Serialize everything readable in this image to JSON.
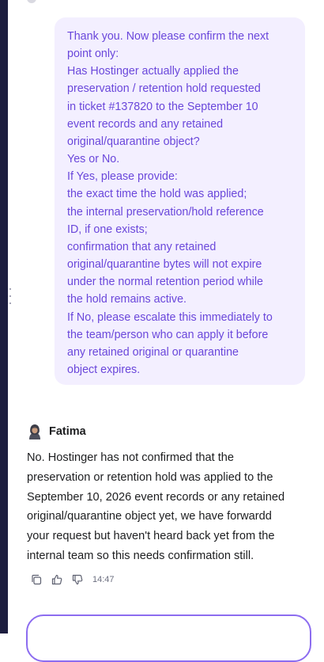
{
  "conversation": {
    "user_message_lines": [
      "Thank you. Now please confirm the next",
      "point only:",
      "Has Hostinger actually applied the",
      "preservation / retention hold requested",
      "in ticket #137820 to the September 10",
      "event records and any retained",
      "original/quarantine object?",
      "Yes or No.",
      "If Yes, please provide:",
      "the exact time the hold was applied;",
      "the internal preservation/hold reference",
      "ID, if one exists;",
      "confirmation that any retained",
      "original/quarantine bytes will not expire",
      "under the normal retention period while",
      "the hold remains active.",
      "If No, please escalate this immediately to",
      "the team/person who can apply it before",
      "any retained original or quarantine",
      "object expires."
    ],
    "assistant": {
      "name": "Fatima",
      "message_lines": [
        "No. Hostinger has not confirmed that the",
        "preservation or retention hold was applied to the",
        "September 10, 2026 event records or any retained",
        "original/quarantine object yet, we have forwardd",
        "your request but haven't heard back yet from the",
        "internal team so this needs confirmation still."
      ],
      "time": "14:47"
    }
  },
  "icons": {
    "copy": "copy-icon",
    "like": "thumbs-up-icon",
    "dislike": "thumbs-down-icon",
    "avatar": "avatar"
  },
  "colors": {
    "rail": "#1d1e3f",
    "user_bubble_bg": "#f3efff",
    "user_text": "#6a47db",
    "assistant_text": "#1d1e20",
    "composer_border": "#8c6cf0"
  }
}
